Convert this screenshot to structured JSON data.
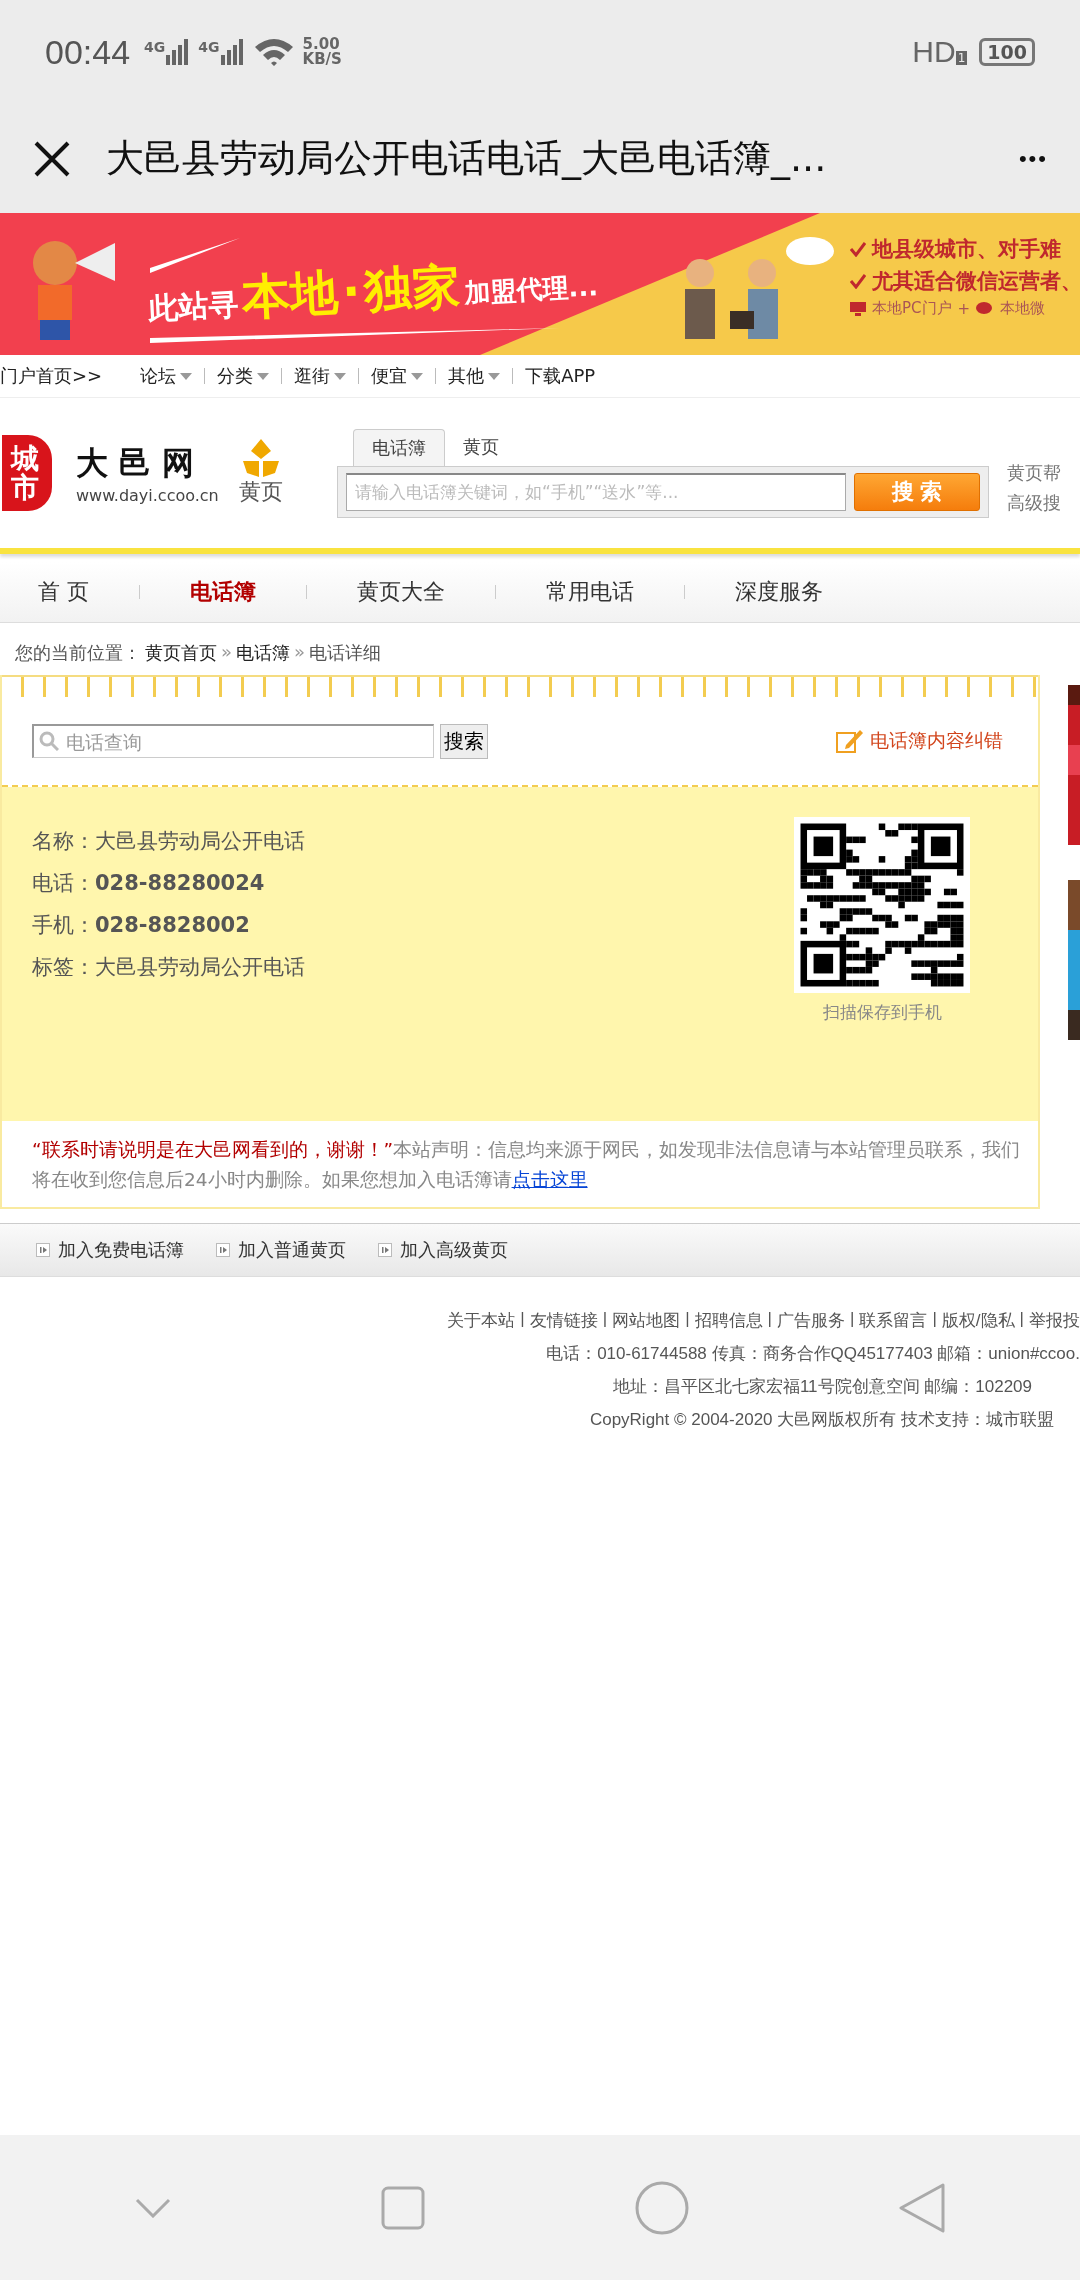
{
  "status_bar": {
    "time": "00:44",
    "networks": [
      "4G",
      "4G"
    ],
    "speed_value": "5.00",
    "speed_unit": "KB/S",
    "hd": "HD",
    "hd_sub": "1",
    "battery": "100"
  },
  "title_bar": {
    "title": "大邑县劳动局公开电话电话_大邑电话簿_...",
    "more": "•••"
  },
  "banner": {
    "lead": "此站寻",
    "strong1": "本地",
    "dot": "·",
    "strong2": "独家",
    "tail": "加盟代理...",
    "points": [
      "地县级城市、对手难",
      "尤其适合微信运营者、"
    ],
    "footer_left": "本地PC门户",
    "plus": "+",
    "footer_right": "本地微"
  },
  "top_links": [
    {
      "label": "门户首页>>",
      "dropdown": false
    },
    {
      "label": "论坛",
      "dropdown": true
    },
    {
      "label": "分类",
      "dropdown": true
    },
    {
      "label": "逛街",
      "dropdown": true
    },
    {
      "label": "便宜",
      "dropdown": true
    },
    {
      "label": "其他",
      "dropdown": true
    },
    {
      "label": "下载APP",
      "dropdown": false
    }
  ],
  "logo": {
    "badge": "城市",
    "name": "大 邑 网",
    "url": "www.dayi.ccoo.cn",
    "section": "黄页"
  },
  "search": {
    "tabs": [
      {
        "label": "电话簿",
        "selected": true
      },
      {
        "label": "黄页",
        "selected": false
      }
    ],
    "placeholder": "请输入电话簿关键词，如“手机”“送水”等...",
    "button": "搜 索",
    "side_links": [
      "黄页帮",
      "高级搜"
    ]
  },
  "nav": [
    {
      "label": "首 页",
      "selected": false
    },
    {
      "label": "电话簿",
      "selected": true
    },
    {
      "label": "黄页大全",
      "selected": false
    },
    {
      "label": "常用电话",
      "selected": false
    },
    {
      "label": "深度服务",
      "selected": false
    }
  ],
  "breadcrumb": {
    "prefix": "您的当前位置：",
    "items": [
      "黄页首页",
      "电话簿",
      "电话详细"
    ],
    "separator": "»"
  },
  "detail": {
    "search_placeholder": "电话查询",
    "search_button": "搜索",
    "report_link": "电话簿内容纠错",
    "fields": [
      {
        "label": "名称：",
        "value": "大邑县劳动局公开电话",
        "bold": false
      },
      {
        "label": "电话：",
        "value": "028-88280024",
        "bold": true
      },
      {
        "label": "手机：",
        "value": "028-8828002",
        "bold": true
      },
      {
        "label": "标签：",
        "value": "大邑县劳动局公开电话",
        "bold": false
      }
    ],
    "qr_caption": "扫描保存到手机",
    "notice_highlight": "“联系时请说明是在大邑网看到的，谢谢！”",
    "notice": "本站声明：信息均来源于网民，如发现非法信息请与本站管理员联系，我们将在收到您信息后24小时内删除。如果您想加入电话簿请",
    "notice_link": "点击这里"
  },
  "bottom_links": [
    "加入免费电话簿",
    "加入普通黄页",
    "加入高级黄页"
  ],
  "footer": {
    "separator": "|",
    "links": [
      "关于本站",
      "友情链接",
      "网站地图",
      "招聘信息",
      "广告服务",
      "联系留言",
      "版权/隐私",
      "举报投"
    ],
    "lines": [
      "电话：010-61744588 传真：商务合作QQ45177403 邮箱：union#ccoo.",
      "地址：昌平区北七家宏福11号院创意空间 邮编：102209",
      "CopyRight © 2004-2020 大邑网版权所有  技术支持：城市联盟"
    ]
  }
}
